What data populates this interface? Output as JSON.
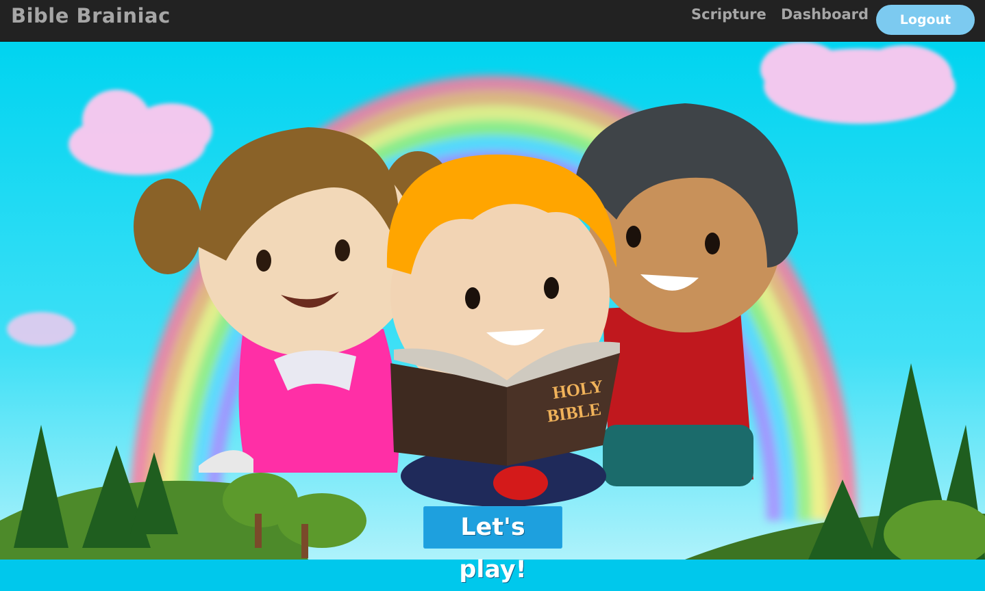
{
  "app": {
    "brand": "Bible Brainiac"
  },
  "nav": {
    "links": [
      {
        "label": "Scripture"
      },
      {
        "label": "Dashboard"
      }
    ],
    "logout_label": "Logout"
  },
  "hero": {
    "book_text_line1": "HOLY",
    "book_text_line2": "BIBLE",
    "cta_label": "Let's play!"
  },
  "colors": {
    "navbar": "#222222",
    "nav_text": "#a6a6a6",
    "logout_button": "#7ccaf0",
    "cta_button": "#1ea0de",
    "sky": "#00c8ec"
  }
}
